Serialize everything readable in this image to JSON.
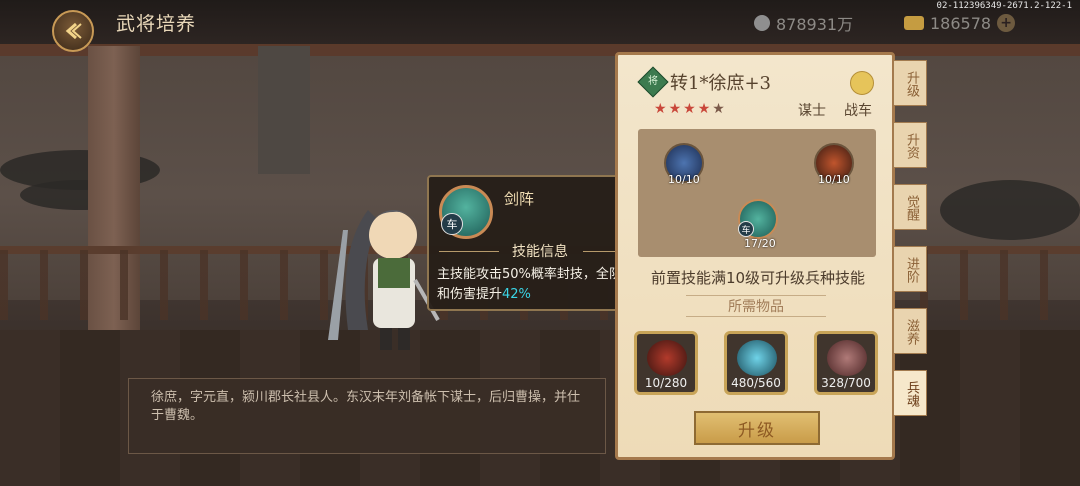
{
  "header": {
    "title": "武将培养",
    "silver": "878931万",
    "gold": "186578",
    "version": "02-112396349-2671.2-122-1"
  },
  "tooltip": {
    "skill_name": "剑阵",
    "badge": "车",
    "section_title": "技能信息",
    "desc_prefix": "主技能攻击50%概率封技，全队行军和伤害提升",
    "desc_highlight": "42%"
  },
  "bio": "徐庶，字元直，颍川郡长社县人。东汉末年刘备帐下谋士，后归曹操，并仕于曹魏。",
  "panel": {
    "rank_badge": "将",
    "hero_name": "转1*徐庶+3",
    "stars_filled": 4,
    "stars_total": 5,
    "role1": "谋士",
    "role2": "战车",
    "nodes": [
      {
        "label": "10/10"
      },
      {
        "label": "10/10"
      },
      {
        "label": "17/20",
        "badge": "车"
      }
    ],
    "prereq": "前置技能满10级可升级兵种技能",
    "required_title": "所需物品",
    "items": [
      {
        "count": "10/280",
        "art": "red-orb-icon"
      },
      {
        "count": "480/560",
        "art": "cyan-crystal-icon"
      },
      {
        "count": "328/700",
        "art": "red-rock-icon"
      }
    ],
    "upgrade_label": "升级"
  },
  "side_tabs": [
    "升级",
    "升资",
    "觉醒",
    "进阶",
    "滋养",
    "兵魂"
  ],
  "active_tab": 5
}
